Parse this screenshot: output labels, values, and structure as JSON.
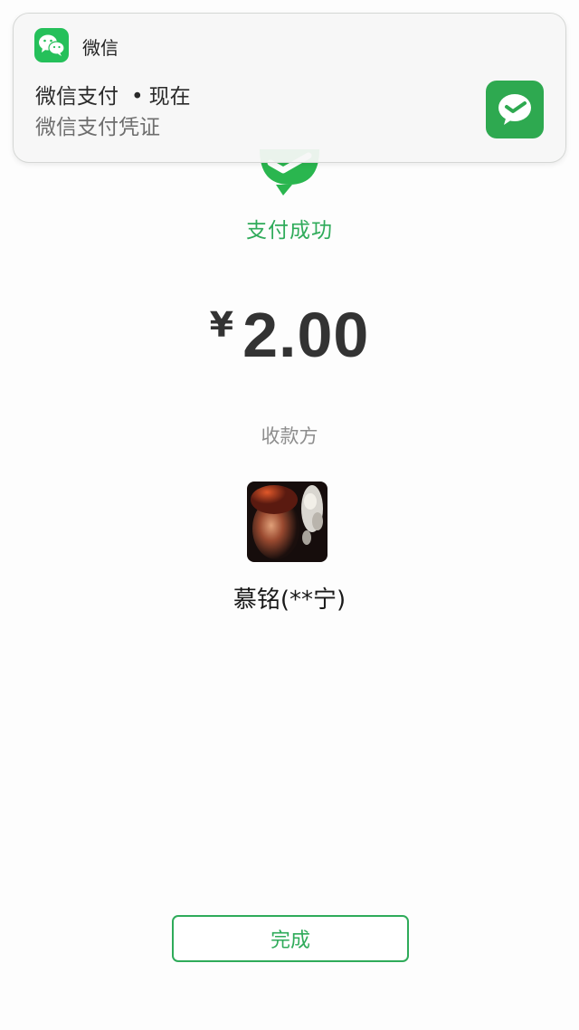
{
  "notification": {
    "app_name": "微信",
    "title": "微信支付",
    "time": "现在",
    "separator": "•",
    "body": "微信支付凭证"
  },
  "payment": {
    "status": "支付成功",
    "currency_symbol": "¥",
    "amount": "2.00",
    "payee_label": "收款方",
    "payee_name": "慕铭(**宁)"
  },
  "actions": {
    "done_label": "完成"
  },
  "icons": {
    "app": "wechat-logo-icon",
    "notification_thumb": "wechat-pay-icon",
    "status": "payment-success-check-icon"
  },
  "colors": {
    "accent": "#2fab5a",
    "wechat_green": "#25c05a",
    "text_primary": "#333333",
    "text_secondary": "#8d8d8d"
  }
}
